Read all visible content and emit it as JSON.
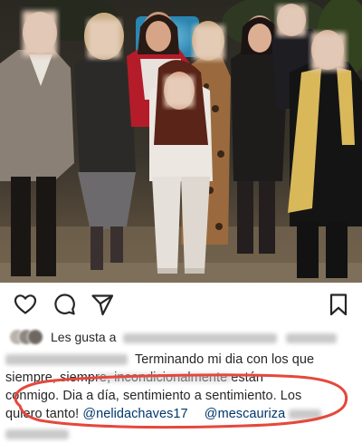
{
  "post": {
    "likes_prefix": "Les gusta a",
    "caption_line_1": "Terminando mi dia con los que",
    "caption_line_2": "siempre, siempre, incondicionalmente están",
    "caption_line_3": "conmigo. Dia a día, sentimiento a sentimiento. Los",
    "caption_line_4": "quiero tanto!",
    "mention_1": "@nelidachaves17",
    "mention_2": "@mescauriza"
  },
  "actions": {
    "like_icon": "heart-icon",
    "comment_icon": "comment-icon",
    "share_icon": "send-icon",
    "save_icon": "bookmark-icon"
  },
  "annotation": {
    "ellipse_color": "#e5483c"
  }
}
